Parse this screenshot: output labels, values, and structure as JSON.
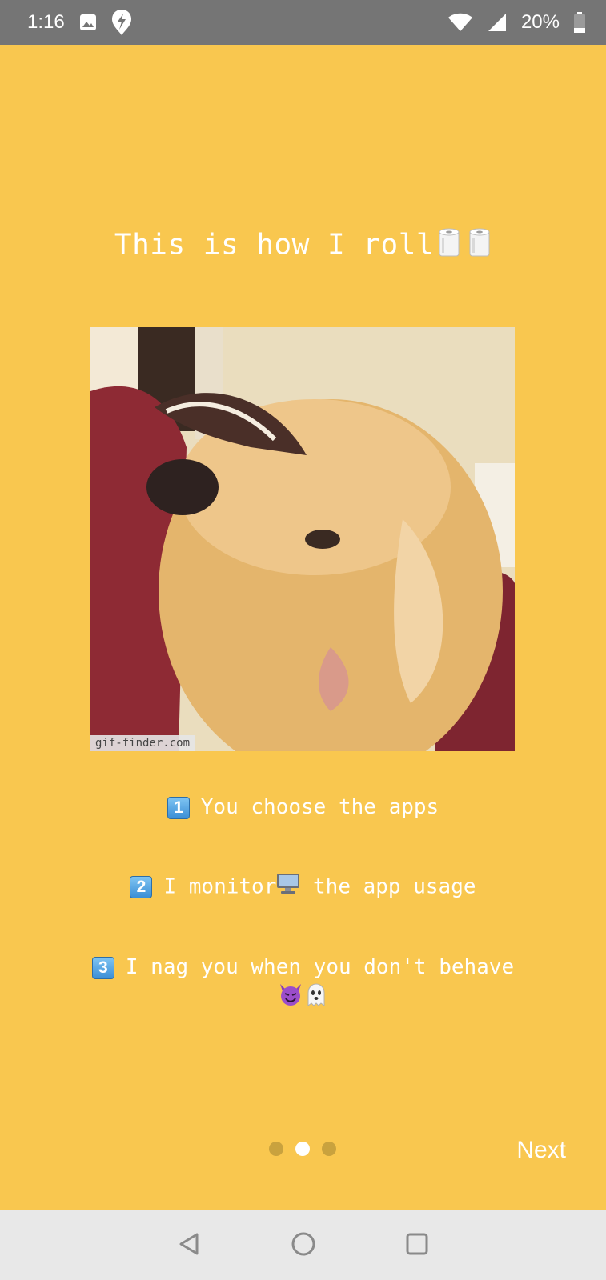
{
  "status_bar": {
    "time": "1:16",
    "battery_percent": "20%",
    "battery_level": 0.2,
    "icons": [
      "image-icon",
      "app-notification-icon",
      "wifi-icon",
      "cell-signal-icon",
      "battery-icon"
    ]
  },
  "onboarding": {
    "title": "This is how I roll",
    "title_emoji": [
      "toilet-paper-icon",
      "toilet-paper-icon"
    ],
    "gif_watermark": "gif-finder.com",
    "steps": [
      {
        "badge": "1",
        "text": "You choose the apps"
      },
      {
        "badge": "2",
        "text_before": "I monitor",
        "emoji": "desktop-computer-icon",
        "text_after": " the app usage"
      },
      {
        "badge": "3",
        "text": "I nag you when you don't behave",
        "emoji": [
          "smiling-devil-icon",
          "ghost-icon"
        ]
      }
    ],
    "pager": {
      "count": 3,
      "active_index": 1
    },
    "next_label": "Next"
  },
  "colors": {
    "background": "#F9C74F",
    "status_bar": "#757575",
    "nav_bar": "#E8E8E8",
    "text": "#FFFFFF"
  },
  "nav_bar": {
    "buttons": [
      "back-icon",
      "home-icon",
      "recents-icon"
    ]
  }
}
